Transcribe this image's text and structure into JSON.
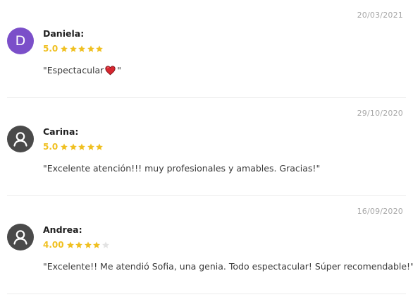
{
  "colors": {
    "star_filled": "#F0C021",
    "star_empty": "#E3E3E3",
    "avatar_letter_bg": "#7B4FC9",
    "avatar_default_bg": "#4A4A4A",
    "heart": "#D6262F"
  },
  "reviews": [
    {
      "date": "20/03/2021",
      "name": "Daniela:",
      "avatar": {
        "type": "letter",
        "letter": "D"
      },
      "score": "5.0",
      "stars": 5,
      "text_before": "\"Espectacular ",
      "text_icon": "red-heart-icon",
      "text_after": "\""
    },
    {
      "date": "29/10/2020",
      "name": "Carina:",
      "avatar": {
        "type": "default-user-icon"
      },
      "score": "5.0",
      "stars": 5,
      "text": "\"Excelente atención!!! muy profesionales y amables. Gracias!\""
    },
    {
      "date": "16/09/2020",
      "name": "Andrea:",
      "avatar": {
        "type": "default-user-icon"
      },
      "score": "4.00",
      "stars": 4,
      "text": "\"Excelente!! Me atendió Sofia, una genia. Todo espectacular! Súper recomendable!\""
    }
  ]
}
